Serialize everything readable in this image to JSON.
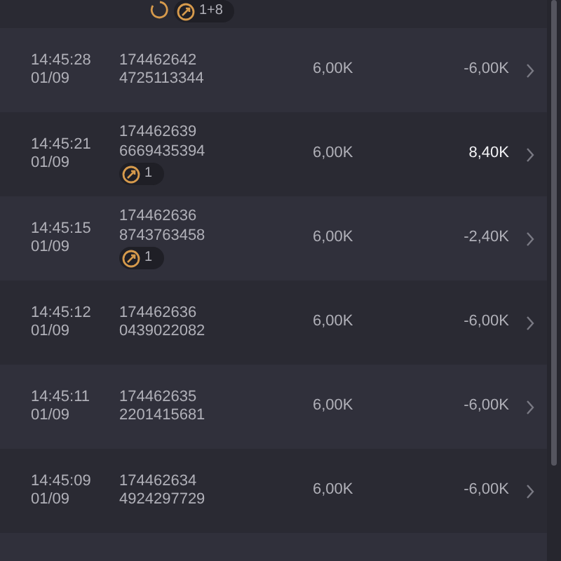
{
  "top_row": {
    "pending": true,
    "badge": "1+8"
  },
  "rows": [
    {
      "time": "14:45:28",
      "date": "01/09",
      "id_line_1": "174462642",
      "id_line_2": "4725113344",
      "amount": "6,00K",
      "result": "-6,00K",
      "win": false
    },
    {
      "time": "14:45:21",
      "date": "01/09",
      "id_line_1": "174462639",
      "id_line_2": "6669435394",
      "badge": "1",
      "amount": "6,00K",
      "result": "8,40K",
      "win": true
    },
    {
      "time": "14:45:15",
      "date": "01/09",
      "id_line_1": "174462636",
      "id_line_2": "8743763458",
      "badge": "1",
      "amount": "6,00K",
      "result": "-2,40K",
      "win": false
    },
    {
      "time": "14:45:12",
      "date": "01/09",
      "id_line_1": "174462636",
      "id_line_2": "0439022082",
      "amount": "6,00K",
      "result": "-6,00K",
      "win": false
    },
    {
      "time": "14:45:11",
      "date": "01/09",
      "id_line_1": "174462635",
      "id_line_2": "2201415681",
      "amount": "6,00K",
      "result": "-6,00K",
      "win": false
    },
    {
      "time": "14:45:09",
      "date": "01/09",
      "id_line_1": "174462634",
      "id_line_2": "4924297729",
      "amount": "6,00K",
      "result": "-6,00K",
      "win": false
    }
  ]
}
